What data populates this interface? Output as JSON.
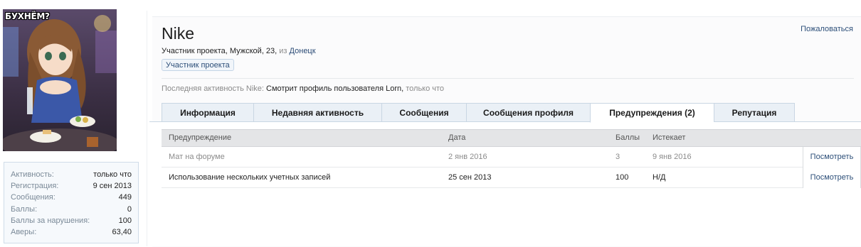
{
  "avatar": {
    "caption": "БУХНЁМ?"
  },
  "sidebar": {
    "stats": [
      {
        "label": "Активность:",
        "value": "только что"
      },
      {
        "label": "Регистрация:",
        "value": "9 сен 2013"
      },
      {
        "label": "Сообщения:",
        "value": "449"
      },
      {
        "label": "Баллы:",
        "value": "0"
      },
      {
        "label": "Баллы за нарушения:",
        "value": "100"
      },
      {
        "label": "Аверы:",
        "value": "63,40"
      }
    ]
  },
  "profile": {
    "username": "Nike",
    "blurb_prefix": "Участник проекта, Мужской, 23, ",
    "blurb_from": "из",
    "location": "Донецк",
    "user_title": "Участник проекта",
    "report_label": "Пожаловаться",
    "last_activity_label": "Последняя активность Nike:",
    "last_activity_action": "Смотрит профиль пользователя Lorn,",
    "last_activity_time": "только что"
  },
  "tabs": [
    {
      "label": "Информация"
    },
    {
      "label": "Недавняя активность"
    },
    {
      "label": "Сообщения"
    },
    {
      "label": "Сообщения профиля"
    },
    {
      "label": "Предупреждения (2)"
    },
    {
      "label": "Репутация"
    }
  ],
  "active_tab": "Предупреждения (2)",
  "warnings_table": {
    "columns": [
      "Предупреждение",
      "Дата",
      "Баллы",
      "Истекает"
    ],
    "rows": [
      {
        "warning": "Мат на форуме",
        "date": "2 янв 2016",
        "points": "3",
        "expires": "9 янв 2016",
        "action": "Посмотреть"
      },
      {
        "warning": "Использование нескольких учетных записей",
        "date": "25 сен 2013",
        "points": "100",
        "expires": "Н/Д",
        "action": "Посмотреть"
      }
    ]
  },
  "colors": {
    "link": "#2d4f79",
    "tab_bg": "#eaf0f6",
    "tab_border": "#c9d6e3",
    "header_row_bg": "#e4e5e7"
  }
}
